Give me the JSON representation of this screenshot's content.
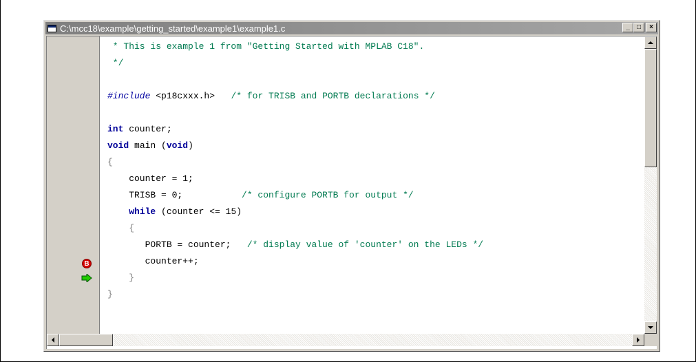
{
  "window": {
    "title": "C:\\mcc18\\example\\getting_started\\example1\\example1.c",
    "buttons": {
      "minimize": "_",
      "maximize": "□",
      "close": "×"
    }
  },
  "code": {
    "line1": " * This is example 1 from \"Getting Started with MPLAB C18\".",
    "line2": " */",
    "include_kw": "#include",
    "include_file": " <p18cxxx.h>",
    "include_comment": "   /* for TRISB and PORTB declarations */",
    "int_kw": "int",
    "counter_decl": " counter;",
    "void_kw": "void",
    "main_decl": " main ",
    "paren_open": "(",
    "void_kw2": "void",
    "paren_close": ")",
    "brace_open1": "{",
    "assign1": "    counter = 1;",
    "trisb": "    TRISB = 0;",
    "trisb_comment": "           /* configure PORTB for output */",
    "while_indent": "    ",
    "while_kw": "while",
    "while_cond": " (counter <= 15)",
    "brace_open2": "    {",
    "portb": "       PORTB = counter;",
    "portb_comment": "   /* display value of 'counter' on the LEDs */",
    "incr": "       counter++;",
    "brace_close2": "    }",
    "brace_close1": "}"
  },
  "gutter": {
    "breakpoint_label": "B",
    "breakpoint_color": "#d40000",
    "pc_arrow_color": "#22cc00"
  }
}
